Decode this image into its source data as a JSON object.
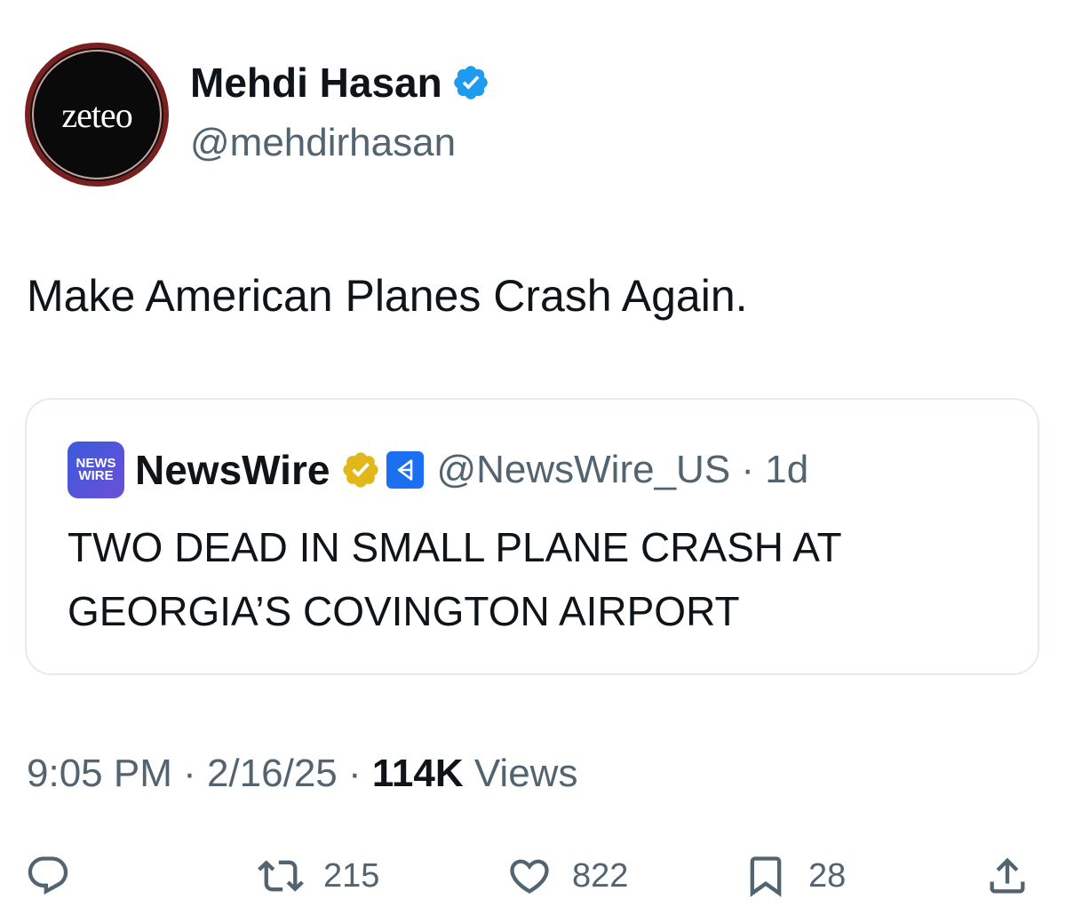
{
  "author": {
    "avatar_text": "zeteo",
    "display_name": "Mehdi Hasan",
    "handle": "@mehdirhasan",
    "verified": true
  },
  "tweet": {
    "text": "Make American Planes Crash Again."
  },
  "quoted": {
    "logo_text_line1": "NEWS",
    "logo_text_line2": "WIRE",
    "name": "NewsWire",
    "handle_time": "@NewsWire_US · 1d",
    "headline": "TWO DEAD IN SMALL PLANE CRASH AT GEORGIA’S COVINGTON AIRPORT"
  },
  "meta": {
    "time_date": "9:05 PM · 2/16/25 · ",
    "views_count": "114K",
    "views_label": " Views"
  },
  "actions": {
    "retweets": "215",
    "likes": "822",
    "bookmarks": "28"
  },
  "colors": {
    "verified_blue": "#1d9bf0",
    "verified_gold": "#e2b719",
    "secondary_text": "#536471",
    "primary_text": "#0f1419"
  },
  "icons": [
    "reply-icon",
    "retweet-icon",
    "like-icon",
    "bookmark-icon",
    "share-icon"
  ]
}
